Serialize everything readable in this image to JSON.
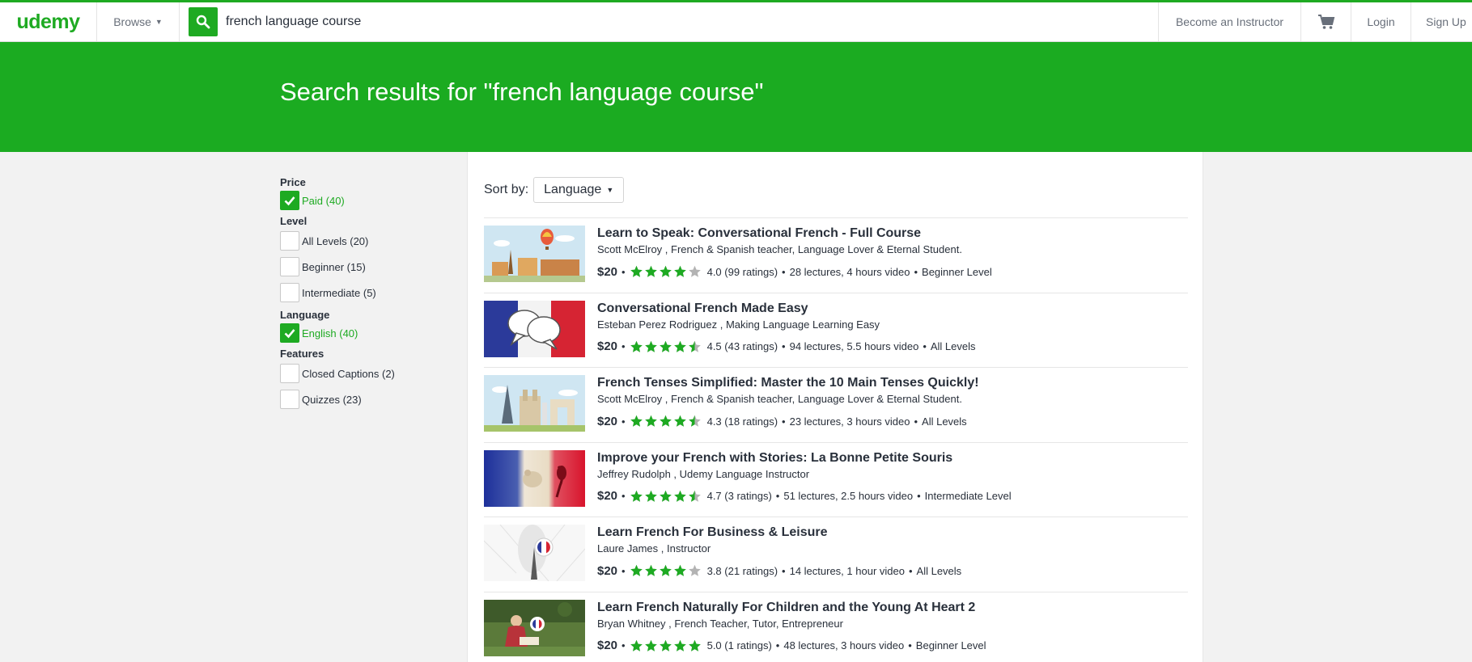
{
  "brand": {
    "logo": "udemy",
    "accent": "#1eaa22"
  },
  "header": {
    "browse_label": "Browse",
    "search_value": "french language course",
    "become_instructor": "Become an Instructor",
    "login": "Login",
    "signup": "Sign Up"
  },
  "banner": {
    "title": "Search results for \"french language course\""
  },
  "filters": {
    "price": {
      "heading": "Price",
      "options": [
        {
          "label": "Paid (40)",
          "checked": true
        }
      ]
    },
    "level": {
      "heading": "Level",
      "options": [
        {
          "label": "All Levels (20)",
          "checked": false
        },
        {
          "label": "Beginner (15)",
          "checked": false
        },
        {
          "label": "Intermediate (5)",
          "checked": false
        }
      ]
    },
    "language": {
      "heading": "Language",
      "options": [
        {
          "label": "English (40)",
          "checked": true
        }
      ]
    },
    "features": {
      "heading": "Features",
      "options": [
        {
          "label": "Closed Captions (2)",
          "checked": false
        },
        {
          "label": "Quizzes (23)",
          "checked": false
        }
      ]
    }
  },
  "sort": {
    "label": "Sort by:",
    "value": "Language"
  },
  "results": [
    {
      "title": "Learn to Speak: Conversational French - Full Course",
      "instructor": "Scott McElroy , French & Spanish teacher, Language Lover & Eternal Student.",
      "price": "$20",
      "rating": 4.0,
      "rating_text": "4.0 (99 ratings)",
      "details": "28 lectures, 4 hours video",
      "level": "Beginner Level",
      "thumb": "paris-balloon"
    },
    {
      "title": "Conversational French Made Easy",
      "instructor": "Esteban Perez Rodriguez , Making Language Learning Easy",
      "price": "$20",
      "rating": 4.5,
      "rating_text": "4.5 (43 ratings)",
      "details": "94 lectures, 5.5 hours video",
      "level": "All Levels",
      "thumb": "flag-speech-bubbles"
    },
    {
      "title": "French Tenses Simplified: Master the 10 Main Tenses Quickly!",
      "instructor": "Scott McElroy , French & Spanish teacher, Language Lover & Eternal Student.",
      "price": "$20",
      "rating": 4.3,
      "rating_text": "4.3 (18 ratings)",
      "details": "23 lectures, 3 hours video",
      "level": "All Levels",
      "thumb": "paris-landmarks"
    },
    {
      "title": "Improve your French with Stories: La Bonne Petite Souris",
      "instructor": "Jeffrey Rudolph , Udemy Language Instructor",
      "price": "$20",
      "rating": 4.7,
      "rating_text": "4.7 (3 ratings)",
      "details": "51 lectures, 2.5 hours video",
      "level": "Intermediate Level",
      "thumb": "flag-mouse"
    },
    {
      "title": "Learn French For Business & Leisure",
      "instructor": "Laure James , Instructor",
      "price": "$20",
      "rating": 3.8,
      "rating_text": "3.8 (21 ratings)",
      "details": "14 lectures, 1 hour video",
      "level": "All Levels",
      "thumb": "eiffel-bubble"
    },
    {
      "title": "Learn French Naturally For Children and the Young At Heart 2",
      "instructor": "Bryan Whitney , French Teacher, Tutor, Entrepreneur",
      "price": "$20",
      "rating": 5.0,
      "rating_text": "5.0 (1 ratings)",
      "details": "48 lectures, 3 hours video",
      "level": "Beginner Level",
      "thumb": "child-reading"
    }
  ]
}
